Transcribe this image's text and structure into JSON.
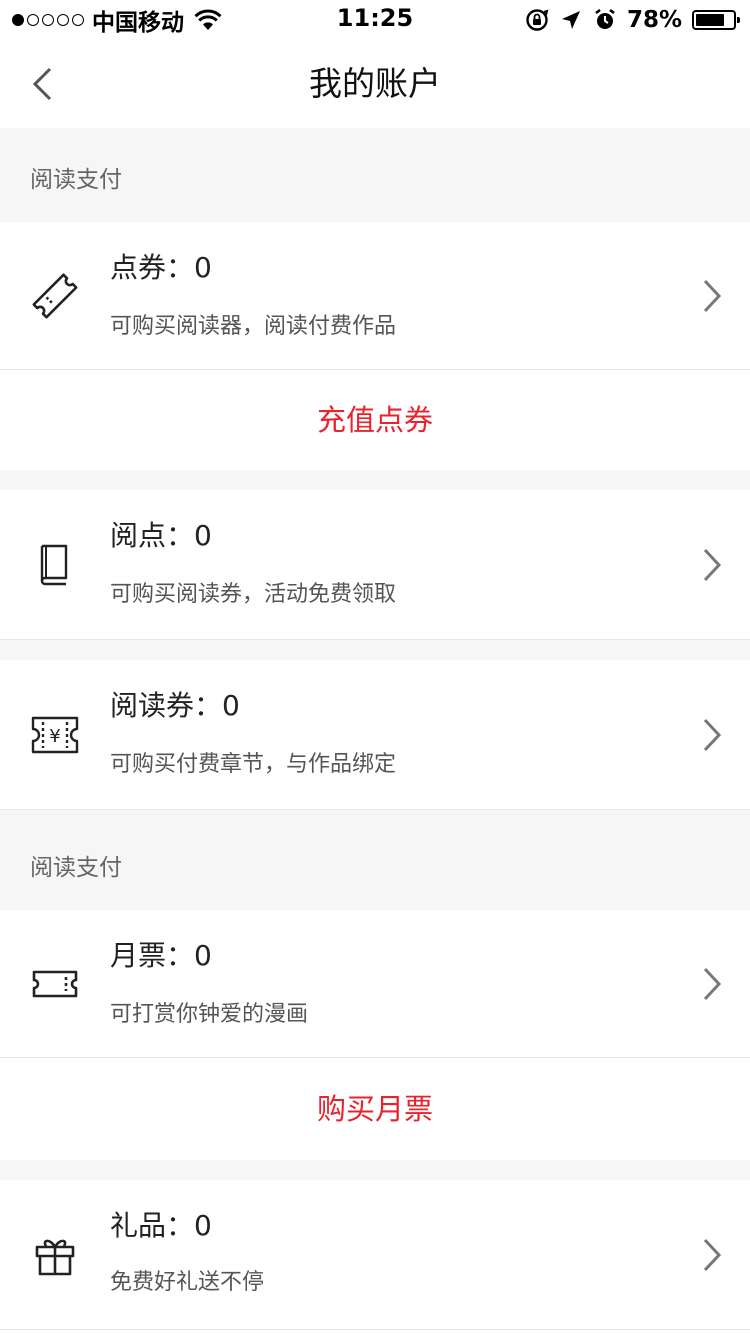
{
  "status_bar": {
    "carrier": "中国移动",
    "time": "11:25",
    "battery": "78%",
    "battery_level": 0.78,
    "signal_bars": 1
  },
  "nav": {
    "title": "我的账户"
  },
  "sections": {
    "reading_pay_1": "阅读支付",
    "reading_pay_2": "阅读支付"
  },
  "items": {
    "coupon": {
      "title": "点券：0",
      "subtitle": "可购买阅读器，阅读付费作品"
    },
    "points": {
      "title": "阅点：0",
      "subtitle": "可购买阅读券，活动免费领取"
    },
    "ticket": {
      "title": "阅读券：0",
      "subtitle": "可购买付费章节，与作品绑定"
    },
    "monthly": {
      "title": "月票：0",
      "subtitle": "可打赏你钟爱的漫画"
    },
    "gift": {
      "title": "礼品：0",
      "subtitle": "免费好礼送不停"
    }
  },
  "actions": {
    "recharge": "充值点券",
    "buy_monthly": "购买月票"
  },
  "colors": {
    "accent": "#e8232c",
    "section_bg": "#f6f6f6",
    "divider": "#e8e8e8"
  }
}
